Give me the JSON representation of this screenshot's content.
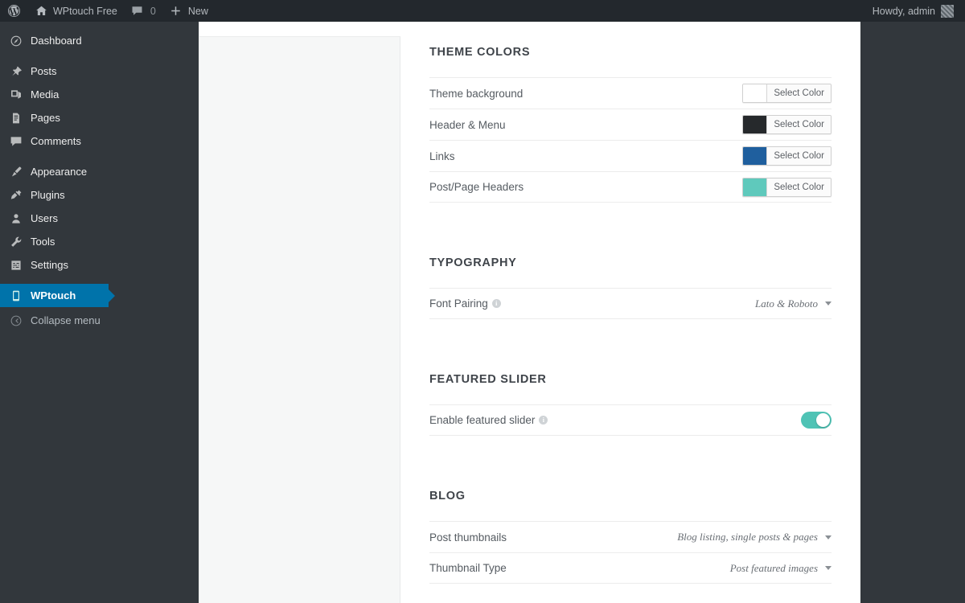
{
  "adminbar": {
    "wp_logo_icon": "wordpress-logo-icon",
    "site_home_icon": "home-icon",
    "site_name": "WPtouch Free",
    "comments_icon": "comment-bubble-icon",
    "comments_count": "0",
    "new_icon": "plus-icon",
    "new_label": "New",
    "howdy": "Howdy, admin",
    "avatar": "avatar"
  },
  "sidebar": {
    "items": [
      {
        "label": "Dashboard",
        "icon": "dashboard-icon",
        "current": false
      },
      {
        "label": "Posts",
        "icon": "pin-icon",
        "current": false
      },
      {
        "label": "Media",
        "icon": "media-icon",
        "current": false
      },
      {
        "label": "Pages",
        "icon": "page-icon",
        "current": false
      },
      {
        "label": "Comments",
        "icon": "comment-bubble-icon",
        "current": false
      },
      {
        "label": "Appearance",
        "icon": "paintbrush-icon",
        "current": false
      },
      {
        "label": "Plugins",
        "icon": "plug-icon",
        "current": false
      },
      {
        "label": "Users",
        "icon": "users-icon",
        "current": false
      },
      {
        "label": "Tools",
        "icon": "wrench-icon",
        "current": false
      },
      {
        "label": "Settings",
        "icon": "settings-sliders-icon",
        "current": false
      },
      {
        "label": "WPtouch",
        "icon": "wptouch-icon",
        "current": true
      }
    ],
    "collapse": {
      "label": "Collapse menu",
      "icon": "collapse-arrow-icon"
    }
  },
  "colors": {
    "accent_blue": "#0073aa",
    "teal": "#4fc3b5",
    "admin_dark": "#23282d",
    "menu_dark": "#32373c"
  },
  "main": {
    "theme_colors": {
      "title": "THEME COLORS",
      "button_label": "Select Color",
      "rows": [
        {
          "label": "Theme background",
          "swatch": "#ffffff"
        },
        {
          "label": "Header & Menu",
          "swatch": "#26292c"
        },
        {
          "label": "Links",
          "swatch": "#1f5f9e"
        },
        {
          "label": "Post/Page Headers",
          "swatch": "#5fc9bc"
        }
      ]
    },
    "typography": {
      "title": "TYPOGRAPHY",
      "rows": [
        {
          "label": "Font Pairing",
          "info": true,
          "value": "Lato & Roboto"
        }
      ]
    },
    "featured_slider": {
      "title": "FEATURED SLIDER",
      "rows": [
        {
          "label": "Enable featured slider",
          "info": true,
          "toggle_on": true
        }
      ]
    },
    "blog": {
      "title": "BLOG",
      "rows": [
        {
          "label": "Post thumbnails",
          "value": "Blog listing, single posts & pages"
        },
        {
          "label": "Thumbnail Type",
          "value": "Post featured images"
        }
      ]
    }
  }
}
